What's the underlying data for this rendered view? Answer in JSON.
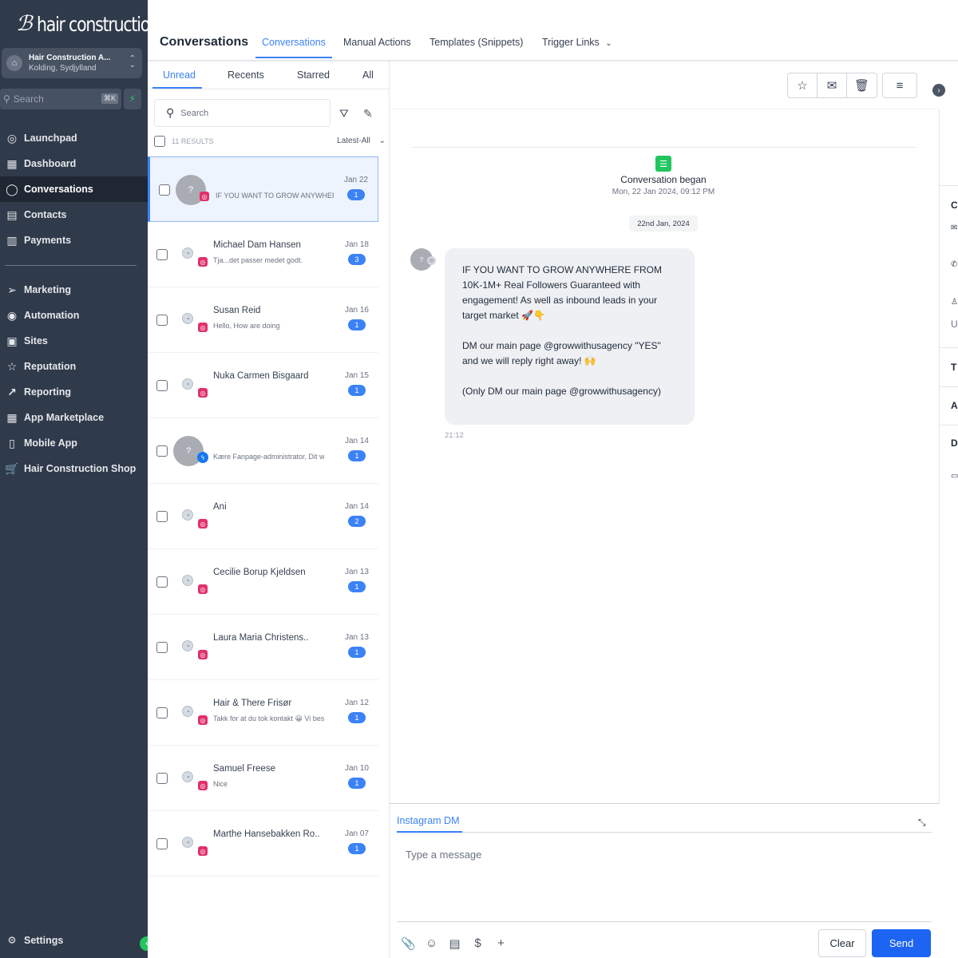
{
  "sidebar": {
    "logo_mark": "ℬ",
    "logo_text": "hair construction",
    "account_name": "Hair Construction A...",
    "account_location": "Kolding, Sydjylland",
    "search_placeholder": "Search",
    "search_shortcut": "⌘K",
    "nav_top": [
      {
        "label": "Launchpad",
        "icon": "rocket-icon"
      },
      {
        "label": "Dashboard",
        "icon": "grid-icon"
      },
      {
        "label": "Conversations",
        "icon": "chat-bubble-icon",
        "active": true
      },
      {
        "label": "Contacts",
        "icon": "contacts-icon"
      },
      {
        "label": "Payments",
        "icon": "receipt-icon"
      }
    ],
    "nav_bottom": [
      {
        "label": "Marketing",
        "icon": "send-icon"
      },
      {
        "label": "Automation",
        "icon": "automation-icon"
      },
      {
        "label": "Sites",
        "icon": "browser-icon"
      },
      {
        "label": "Reputation",
        "icon": "star-icon"
      },
      {
        "label": "Reporting",
        "icon": "trend-icon"
      },
      {
        "label": "App Marketplace",
        "icon": "apps-grid-icon"
      },
      {
        "label": "Mobile App",
        "icon": "mobile-icon"
      },
      {
        "label": "Hair Construction Shop",
        "icon": "cart-icon"
      }
    ],
    "settings_label": "Settings"
  },
  "topbar": {
    "title": "Conversations",
    "tabs": [
      "Conversations",
      "Manual Actions",
      "Templates (Snippets)",
      "Trigger Links"
    ],
    "active_tab": "Conversations"
  },
  "list": {
    "tabs": [
      "Unread",
      "Recents",
      "Starred",
      "All"
    ],
    "active_tab": "Unread",
    "search_placeholder": "Search",
    "results_count": "11 RESULTS",
    "sort_label": "Latest-All",
    "conversations": [
      {
        "name": "",
        "preview": "IF YOU WANT TO GROW ANYWHERE",
        "date": "Jan 22",
        "unread": "1",
        "channel": "instagram",
        "avatar": "?",
        "selected": true
      },
      {
        "name": "Michael Dam Hansen",
        "preview": "Tja...det passer medet godt.",
        "date": "Jan 18",
        "unread": "3",
        "channel": "instagram",
        "avatar": ""
      },
      {
        "name": "Susan Reid",
        "preview": "Hello, How are doing",
        "date": "Jan 16",
        "unread": "1",
        "channel": "instagram",
        "avatar": ""
      },
      {
        "name": "Nuka Carmen Bisgaard",
        "preview": "",
        "date": "Jan 15",
        "unread": "1",
        "channel": "instagram",
        "avatar": ""
      },
      {
        "name": "",
        "preview": "Kære Fanpage-administrator, Dit w",
        "date": "Jan 14",
        "unread": "1",
        "channel": "messenger",
        "avatar": "?"
      },
      {
        "name": "Ani",
        "preview": "",
        "date": "Jan 14",
        "unread": "2",
        "channel": "instagram",
        "avatar": ""
      },
      {
        "name": "Cecilie Borup Kjeldsen",
        "preview": "",
        "date": "Jan 13",
        "unread": "1",
        "channel": "instagram",
        "avatar": ""
      },
      {
        "name": "Laura Maria Christens..",
        "preview": "",
        "date": "Jan 13",
        "unread": "1",
        "channel": "instagram",
        "avatar": ""
      },
      {
        "name": "Hair & There Frisør",
        "preview": "Takk for at du tok kontakt 😀 Vi bes",
        "date": "Jan 12",
        "unread": "1",
        "channel": "instagram",
        "avatar": ""
      },
      {
        "name": "Samuel Freese",
        "preview": "Nice",
        "date": "Jan 10",
        "unread": "1",
        "channel": "instagram",
        "avatar": ""
      },
      {
        "name": "Marthe Hansebakken Ro..",
        "preview": "",
        "date": "Jan 07",
        "unread": "1",
        "channel": "instagram",
        "avatar": ""
      }
    ]
  },
  "chat": {
    "began_title": "Conversation began",
    "began_date": "Mon, 22 Jan 2024, 09:12 PM",
    "date_divider": "22nd Jan, 2024",
    "avatar": "?",
    "message_paragraphs": [
      "IF YOU WANT TO GROW ANYWHERE FROM 10K-1M+ Real Followers Guaranteed with engagement! As well as inbound leads in your target market 🚀👇",
      "DM our main page @growwithusagency \"YES\" and we will reply right away! 🙌",
      "(Only DM our main page @growwithusagency)"
    ],
    "message_time": "21:12"
  },
  "composer": {
    "channel_tab": "Instagram DM",
    "placeholder": "Type a message",
    "clear_label": "Clear",
    "send_label": "Send"
  },
  "rightpanel": {
    "letters": [
      "C",
      "T",
      "A",
      "D"
    ],
    "u_label": "U"
  },
  "colors": {
    "accent": "#3b82f6",
    "sidebar_bg": "#2f3a4a",
    "send_button": "#1d64f2",
    "badge": "#3b82f6",
    "instagram": "#e1306c",
    "messenger": "#1877f2",
    "success": "#22c55e"
  }
}
